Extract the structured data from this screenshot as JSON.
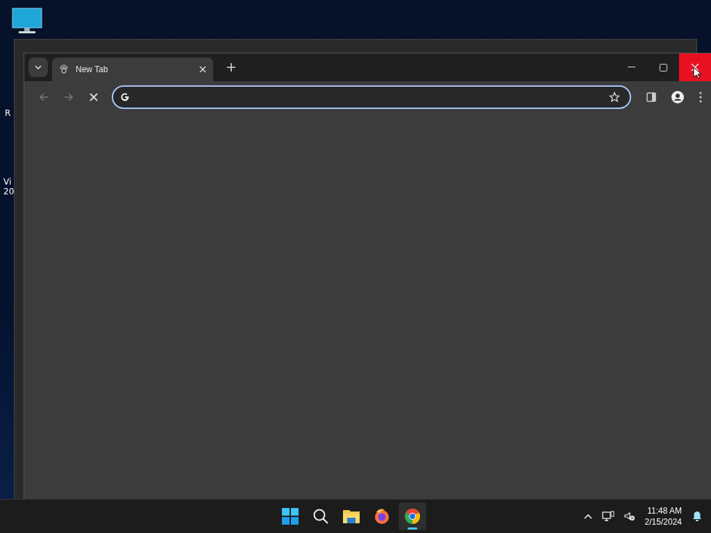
{
  "desktop": {
    "labels": [
      "R",
      "Vi",
      "20"
    ]
  },
  "browser": {
    "tabs": [
      {
        "title": "New Tab",
        "selected": true
      }
    ],
    "loading": true,
    "close_hovered": true
  },
  "taskbar": {
    "apps": [
      {
        "kind": "start",
        "active": false
      },
      {
        "kind": "search",
        "active": false
      },
      {
        "kind": "files",
        "active": false
      },
      {
        "kind": "firefox",
        "active": false
      },
      {
        "kind": "chrome",
        "active": true
      }
    ],
    "time": "11:48 AM",
    "date": "2/15/2024"
  }
}
